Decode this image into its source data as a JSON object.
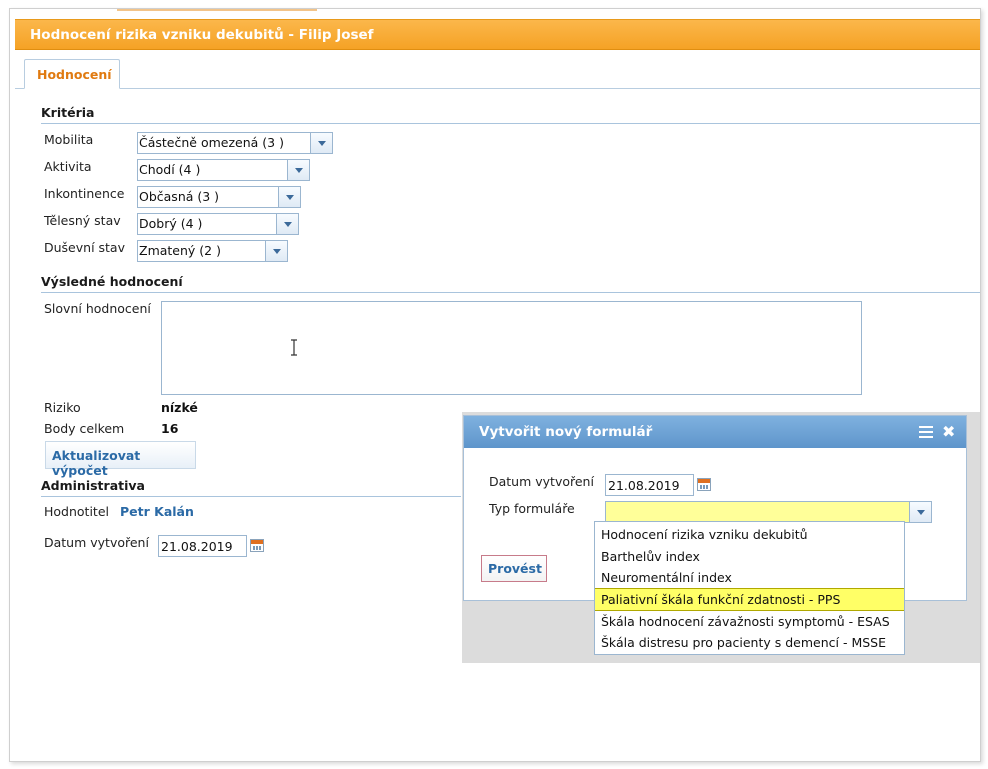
{
  "window": {
    "title": "Hodnocení rizika vzniku dekubitů - Filip Josef"
  },
  "tabs": [
    {
      "label": "Hodnocení",
      "active": true
    }
  ],
  "criteria": {
    "title": "Kritéria",
    "fields": [
      {
        "label": "Mobilita",
        "value": "Částečně omezená (3 )"
      },
      {
        "label": "Aktivita",
        "value": "Chodí (4 )"
      },
      {
        "label": "Inkontinence",
        "value": "Občasná (3 )"
      },
      {
        "label": "Tělesný stav",
        "value": "Dobrý (4 )"
      },
      {
        "label": "Duševní stav",
        "value": "Zmatený (2 )"
      }
    ]
  },
  "result": {
    "title": "Výsledné hodnocení",
    "verbal_label": "Slovní hodnocení",
    "verbal_value": "",
    "risk_label": "Riziko",
    "risk_value": "nízké",
    "points_label": "Body celkem",
    "points_value": "16",
    "update_button": "Aktualizovat výpočet"
  },
  "admin": {
    "title": "Administrativa",
    "assessor_label": "Hodnotitel",
    "assessor_value": "Petr Kalán",
    "created_label": "Datum vytvoření",
    "created_value": "21.08.2019"
  },
  "dialog": {
    "title": "Vytvořit nový formulář",
    "date_label": "Datum vytvoření",
    "date_value": "21.08.2019",
    "type_label": "Typ formuláře",
    "type_value": "",
    "run_button": "Provést",
    "options": [
      "Hodnocení rizika vzniku dekubitů",
      "Barthelův index",
      "Neuromentální index",
      "Paliativní škála funkční zdatnosti - PPS",
      "Škála hodnocení závažnosti symptomů - ESAS",
      "Škála distresu pro pacienty s demencí - MSSE"
    ],
    "highlighted_option": "Paliativní škála funkční zdatnosti - PPS"
  },
  "colors": {
    "title_orange": "#f5a225",
    "dialog_blue": "#5e95cb",
    "link_blue": "#2b6aa6",
    "highlight_yellow": "#ffff66"
  }
}
